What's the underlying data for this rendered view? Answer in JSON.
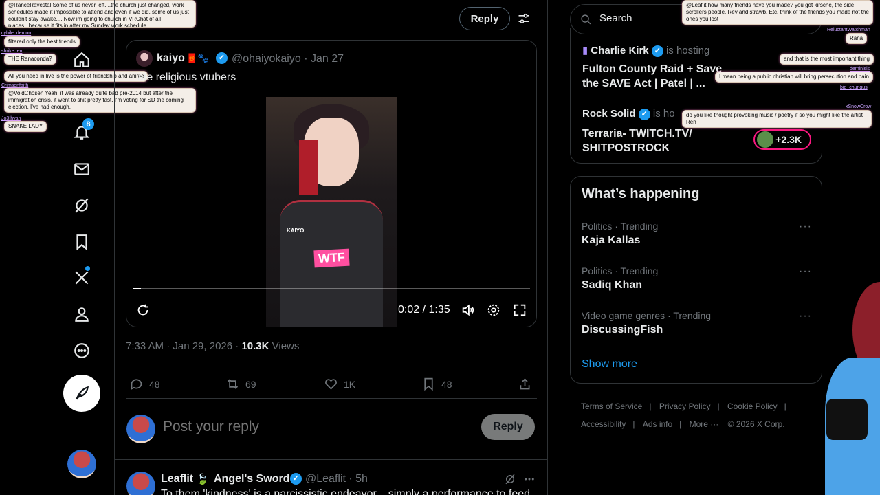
{
  "leftnav": {
    "notif_badge": "8"
  },
  "chat_left": [
    {
      "user": "",
      "text": "@RanceRavestal Some of us never left....the church just changed, work schedules made it impossible to attend and even if we did, some of us just couldn't stay awake.....Now im going to church in VRChat of all places...because it fits in after my Sunday work schedule."
    },
    {
      "user": "cybile_demon",
      "text": "filtered only the best friends"
    },
    {
      "user": "shrike_en",
      "text": "THE Ranaconda?"
    },
    {
      "user": "",
      "text": "All you need in live is the power of friendship and anime"
    },
    {
      "user": "Crimsonfaith",
      "text": "@VoidChosen Yeah, it was already quite bad pre-2014 but after the immigration crisis, it went to shit pretty fast. I'm voting for SD the coming election, I've had enough."
    },
    {
      "user": "Jo3Ihvan",
      "text": "SNAKE LADY"
    }
  ],
  "header": {
    "reply_label": "Reply"
  },
  "quote": {
    "name": "kaiyo",
    "emojis": "🧧🐾",
    "handle_date": "@ohaiyokaiyo · Jan 27",
    "text": "ate religious vtubers",
    "video_wtf": "WTF",
    "video_tag": "KAIYO",
    "time": "0:02 / 1:35",
    "progress": 0.02
  },
  "meta": {
    "time": "7:33 AM · Jan 29, 2026 · ",
    "views_count": "10.3K",
    "views_label": " Views"
  },
  "actions": {
    "replies": "48",
    "reposts": "69",
    "likes": "1K",
    "bookmarks": "48"
  },
  "reply_box": {
    "placeholder": "Post your reply",
    "button": "Reply"
  },
  "next_post": {
    "name": "Leaflit",
    "leaf": "🍃",
    "name2": "Angel's Sword",
    "handle_time": "@Leaflit · 5h",
    "text": "To them 'kindness' is a narcissistic endeavor... simply a performance to feed"
  },
  "search": {
    "placeholder": "Search"
  },
  "live": [
    {
      "host_name": "Charlie Kirk",
      "host_label": "is hosting",
      "title": "Fulton County Raid + Save the SAVE Act | Patel | ..."
    },
    {
      "host_name": "Rock Solid",
      "host_label": "is ho",
      "title": "Terraria- TWITCH.TV/ SHITPOSTROCK",
      "listeners": "+2.3K"
    }
  ],
  "happening": {
    "title": "What’s happening",
    "trends": [
      {
        "category": "Politics · Trending",
        "topic": "Kaja Kallas"
      },
      {
        "category": "Politics · Trending",
        "topic": "Sadiq Khan"
      },
      {
        "category": "Video game genres · Trending",
        "topic": "DiscussingFish"
      }
    ],
    "show_more": "Show more"
  },
  "footer": {
    "links": [
      "Terms of Service",
      "Privacy Policy",
      "Cookie Policy",
      "Accessibility",
      "Ads info",
      "More ···",
      "© 2026 X Corp."
    ]
  },
  "chat_right": [
    {
      "user": "",
      "text": "@Leaflit how many friends have you made? you got kirsche, the side scrollers people, Rev and strawb, Etc. think of the friends you made not the ones you lost"
    },
    {
      "user": "ReluctantWatchman",
      "text": "Rana"
    },
    {
      "user": "",
      "text": "and that is the most important thing"
    },
    {
      "user": "deminisis",
      "text": "I mean being a public christian will bring persecution and pain"
    },
    {
      "user": "big_chungus",
      "text": ""
    },
    {
      "user": "xSnowCrow",
      "text": "do you like thought provoking music / poetry if so you might like the artist Ren"
    }
  ]
}
